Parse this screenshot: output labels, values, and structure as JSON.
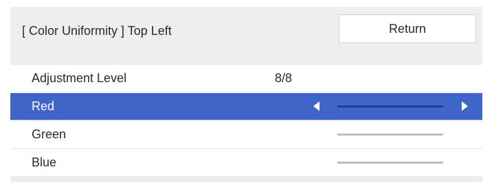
{
  "header": {
    "title": "[ Color Uniformity ] Top Left",
    "return_label": "Return"
  },
  "items": [
    {
      "label": "Adjustment Level",
      "value": "8/8"
    },
    {
      "label": "Red",
      "selected": true,
      "level": null
    },
    {
      "label": "Green"
    },
    {
      "label": "Blue"
    }
  ],
  "colors": {
    "panel_background": "#eeeeee",
    "row_background": "#ffffff",
    "selected_background": "#3f65c8",
    "selected_track": "#1f3d8f",
    "track": "#bdbdbd"
  },
  "icons": {
    "decrease": "triangle-left-icon",
    "increase": "triangle-right-icon"
  }
}
